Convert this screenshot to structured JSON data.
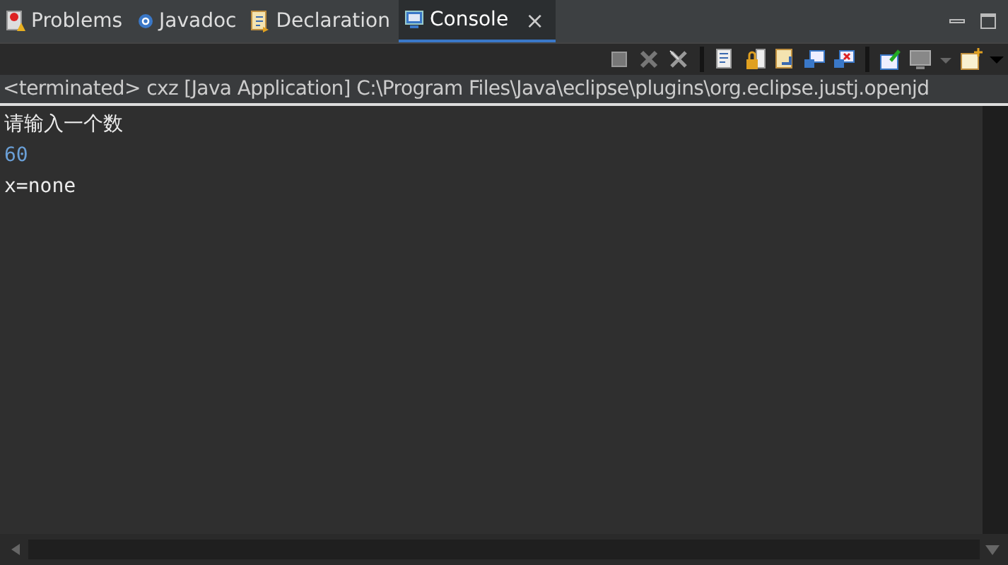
{
  "tabs": [
    {
      "label": "Problems",
      "kind": "problems",
      "selected": false
    },
    {
      "label": "Javadoc",
      "kind": "javadoc",
      "selected": false
    },
    {
      "label": "Declaration",
      "kind": "declaration",
      "selected": false
    },
    {
      "label": "Console",
      "kind": "console",
      "selected": true,
      "close_glyph": "×"
    }
  ],
  "status_line": "<terminated> cxz [Java Application] C:\\Program Files\\Java\\eclipse\\plugins\\org.eclipse.justj.openjd",
  "console_lines": [
    {
      "text": "请输入一个数",
      "kind": "output"
    },
    {
      "text": "60",
      "kind": "input"
    },
    {
      "text": "x=none",
      "kind": "output"
    }
  ]
}
